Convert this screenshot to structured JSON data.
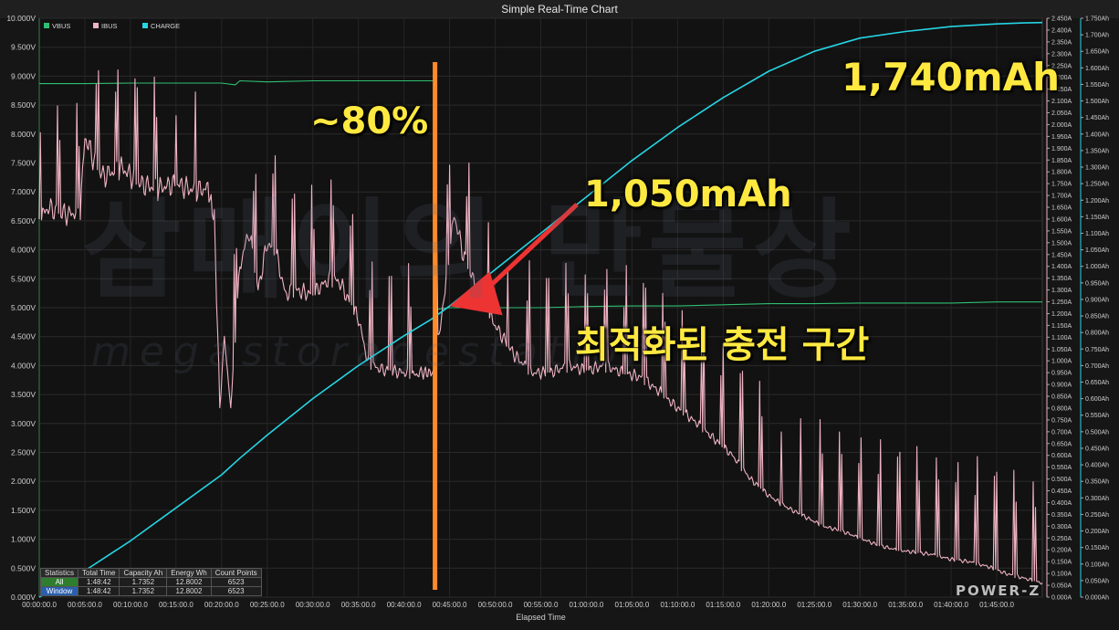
{
  "chart_data": {
    "type": "line",
    "title": "Simple Real-Time Chart",
    "xlabel": "Elapsed Time",
    "x_ticks": [
      "00:00:00.0",
      "00:05:00.0",
      "00:10:00.0",
      "00:15:00.0",
      "00:20:00.0",
      "00:25:00.0",
      "00:30:00.0",
      "00:35:00.0",
      "00:40:00.0",
      "00:45:00.0",
      "00:50:00.0",
      "00:55:00.0",
      "01:00:00.0",
      "01:05:00.0",
      "01:10:00.0",
      "01:15:00.0",
      "01:20:00.0",
      "01:25:00.0",
      "01:30:00.0",
      "01:35:00.0",
      "01:40:00.0",
      "01:45:00.0"
    ],
    "x_range_min": [
      0,
      110
    ],
    "y_left_range": [
      0,
      10
    ],
    "y_left_ticks": [
      "0.000V",
      "0.500V",
      "1.000V",
      "1.500V",
      "2.000V",
      "2.500V",
      "3.000V",
      "3.500V",
      "4.000V",
      "4.500V",
      "5.000V",
      "5.500V",
      "6.000V",
      "6.500V",
      "7.000V",
      "7.500V",
      "8.000V",
      "8.500V",
      "9.000V",
      "9.500V",
      "10.000V"
    ],
    "y_mid_range": [
      0,
      2.45
    ],
    "y_mid_ticks": [
      "0.000A",
      "0.050A",
      "0.100A",
      "0.150A",
      "0.200A",
      "0.250A",
      "0.300A",
      "0.350A",
      "0.400A",
      "0.450A",
      "0.500A",
      "0.550A",
      "0.600A",
      "0.650A",
      "0.700A",
      "0.750A",
      "0.800A",
      "0.850A",
      "0.900A",
      "0.950A",
      "1.000A",
      "1.050A",
      "1.100A",
      "1.150A",
      "1.200A",
      "1.250A",
      "1.300A",
      "1.350A",
      "1.400A",
      "1.450A",
      "1.500A",
      "1.550A",
      "1.600A",
      "1.650A",
      "1.700A",
      "1.750A",
      "1.800A",
      "1.850A",
      "1.900A",
      "1.950A",
      "2.000A",
      "2.050A",
      "2.100A",
      "2.150A",
      "2.200A",
      "2.250A",
      "2.300A",
      "2.350A",
      "2.400A",
      "2.450A"
    ],
    "y_right_range": [
      0,
      1.75
    ],
    "y_right_ticks": [
      "0.000Ah",
      "0.050Ah",
      "0.100Ah",
      "0.150Ah",
      "0.200Ah",
      "0.250Ah",
      "0.300Ah",
      "0.350Ah",
      "0.400Ah",
      "0.450Ah",
      "0.500Ah",
      "0.550Ah",
      "0.600Ah",
      "0.650Ah",
      "0.700Ah",
      "0.750Ah",
      "0.800Ah",
      "0.850Ah",
      "0.900Ah",
      "0.950Ah",
      "1.000Ah",
      "1.050Ah",
      "1.100Ah",
      "1.150Ah",
      "1.200Ah",
      "1.250Ah",
      "1.300Ah",
      "1.350Ah",
      "1.400Ah",
      "1.450Ah",
      "1.500Ah",
      "1.550Ah",
      "1.600Ah",
      "1.650Ah",
      "1.700Ah",
      "1.750Ah"
    ],
    "grid": true,
    "legend_placement": "top-left",
    "series": [
      {
        "name": "VBUS",
        "color": "#2fbf71",
        "axis": "left",
        "points": [
          [
            0,
            8.87
          ],
          [
            5,
            8.87
          ],
          [
            10,
            8.88
          ],
          [
            15,
            8.88
          ],
          [
            20,
            8.88
          ],
          [
            21.5,
            8.85
          ],
          [
            22,
            8.92
          ],
          [
            25,
            8.9
          ],
          [
            30,
            8.92
          ],
          [
            35,
            8.92
          ],
          [
            40,
            8.92
          ],
          [
            43.3,
            8.92
          ],
          [
            43.4,
            4.97
          ],
          [
            45,
            5.0
          ],
          [
            50,
            5.0
          ],
          [
            55,
            5.0
          ],
          [
            60,
            5.02
          ],
          [
            65,
            5.03
          ],
          [
            70,
            5.03
          ],
          [
            75,
            5.05
          ],
          [
            80,
            5.07
          ],
          [
            85,
            5.07
          ],
          [
            90,
            5.08
          ],
          [
            95,
            5.08
          ],
          [
            100,
            5.08
          ],
          [
            105,
            5.1
          ],
          [
            110,
            5.1
          ]
        ]
      },
      {
        "name": "IBUS",
        "color": "#f0b3c3",
        "axis": "mid",
        "points": [
          [
            0,
            1.6
          ],
          [
            1,
            1.65
          ],
          [
            2,
            1.63
          ],
          [
            3,
            1.62
          ],
          [
            4.5,
            1.63
          ],
          [
            5,
            1.95
          ],
          [
            6,
            1.85
          ],
          [
            7,
            1.78
          ],
          [
            9,
            1.82
          ],
          [
            11,
            1.75
          ],
          [
            13,
            1.73
          ],
          [
            15,
            1.75
          ],
          [
            17,
            1.72
          ],
          [
            18.5,
            1.73
          ],
          [
            19.2,
            1.6
          ],
          [
            19.8,
            0.81
          ],
          [
            20.3,
            1.1
          ],
          [
            21,
            0.8
          ],
          [
            22,
            1.4
          ],
          [
            23,
            1.55
          ],
          [
            24,
            1.3
          ],
          [
            25,
            1.5
          ],
          [
            26,
            1.45
          ],
          [
            27,
            1.28
          ],
          [
            28,
            1.3
          ],
          [
            30,
            1.28
          ],
          [
            31,
            1.32
          ],
          [
            32,
            1.35
          ],
          [
            33,
            1.33
          ],
          [
            34,
            1.25
          ],
          [
            35,
            1.18
          ],
          [
            36,
            1.0
          ],
          [
            37,
            0.97
          ],
          [
            38,
            0.96
          ],
          [
            40,
            0.95
          ],
          [
            41,
            0.94
          ],
          [
            42,
            0.95
          ],
          [
            43.2,
            0.95
          ],
          [
            44.5,
            1.3
          ],
          [
            45.5,
            1.62
          ],
          [
            46.5,
            1.45
          ],
          [
            48,
            1.3
          ],
          [
            50,
            1.15
          ],
          [
            52,
            1.03
          ],
          [
            54,
            0.95
          ],
          [
            56,
            0.95
          ],
          [
            58,
            0.98
          ],
          [
            60,
            0.96
          ],
          [
            62,
            0.98
          ],
          [
            64,
            0.95
          ],
          [
            66,
            0.93
          ],
          [
            68,
            0.87
          ],
          [
            70,
            0.8
          ],
          [
            72,
            0.74
          ],
          [
            74,
            0.67
          ],
          [
            76,
            0.6
          ],
          [
            78,
            0.5
          ],
          [
            80,
            0.43
          ],
          [
            82,
            0.38
          ],
          [
            84,
            0.34
          ],
          [
            86,
            0.3
          ],
          [
            88,
            0.28
          ],
          [
            90,
            0.25
          ],
          [
            92,
            0.22
          ],
          [
            94,
            0.2
          ],
          [
            96,
            0.19
          ],
          [
            98,
            0.18
          ],
          [
            100,
            0.16
          ],
          [
            102,
            0.15
          ],
          [
            104,
            0.13
          ],
          [
            106,
            0.1
          ],
          [
            108,
            0.08
          ],
          [
            110,
            0.06
          ]
        ]
      },
      {
        "name": "CHARGE",
        "color": "#26d4e3",
        "axis": "right",
        "points": [
          [
            0,
            0.0
          ],
          [
            5,
            0.08
          ],
          [
            10,
            0.17
          ],
          [
            15,
            0.27
          ],
          [
            20,
            0.37
          ],
          [
            22,
            0.42
          ],
          [
            25,
            0.49
          ],
          [
            30,
            0.6
          ],
          [
            35,
            0.7
          ],
          [
            40,
            0.79
          ],
          [
            43,
            0.84
          ],
          [
            45,
            0.88
          ],
          [
            50,
            0.99
          ],
          [
            55,
            1.1
          ],
          [
            60,
            1.21
          ],
          [
            65,
            1.32
          ],
          [
            70,
            1.42
          ],
          [
            75,
            1.51
          ],
          [
            80,
            1.59
          ],
          [
            85,
            1.65
          ],
          [
            90,
            1.69
          ],
          [
            95,
            1.71
          ],
          [
            100,
            1.725
          ],
          [
            105,
            1.733
          ],
          [
            108,
            1.736
          ],
          [
            110,
            1.737
          ]
        ]
      }
    ],
    "annotations": {
      "pct": "~80%",
      "mid_charge": "1,050mAh",
      "final_charge": "1,740mAh",
      "zone": "최적화된 충전 구간",
      "marker_minute": 43.3
    }
  },
  "watermark": {
    "ko": "삼매이의 만물상",
    "en": "megastoragestation"
  },
  "logo": "POWER-Z",
  "stats": {
    "headers": [
      "Statistics",
      "Total Time",
      "Capacity Ah",
      "Energy Wh",
      "Count Points"
    ],
    "rows": [
      {
        "label": "All",
        "total_time": "1:48:42",
        "capacity": "1.7352",
        "energy": "12.8002",
        "count": "6523"
      },
      {
        "label": "Window",
        "total_time": "1:48:42",
        "capacity": "1.7352",
        "energy": "12.8002",
        "count": "6523"
      }
    ]
  }
}
